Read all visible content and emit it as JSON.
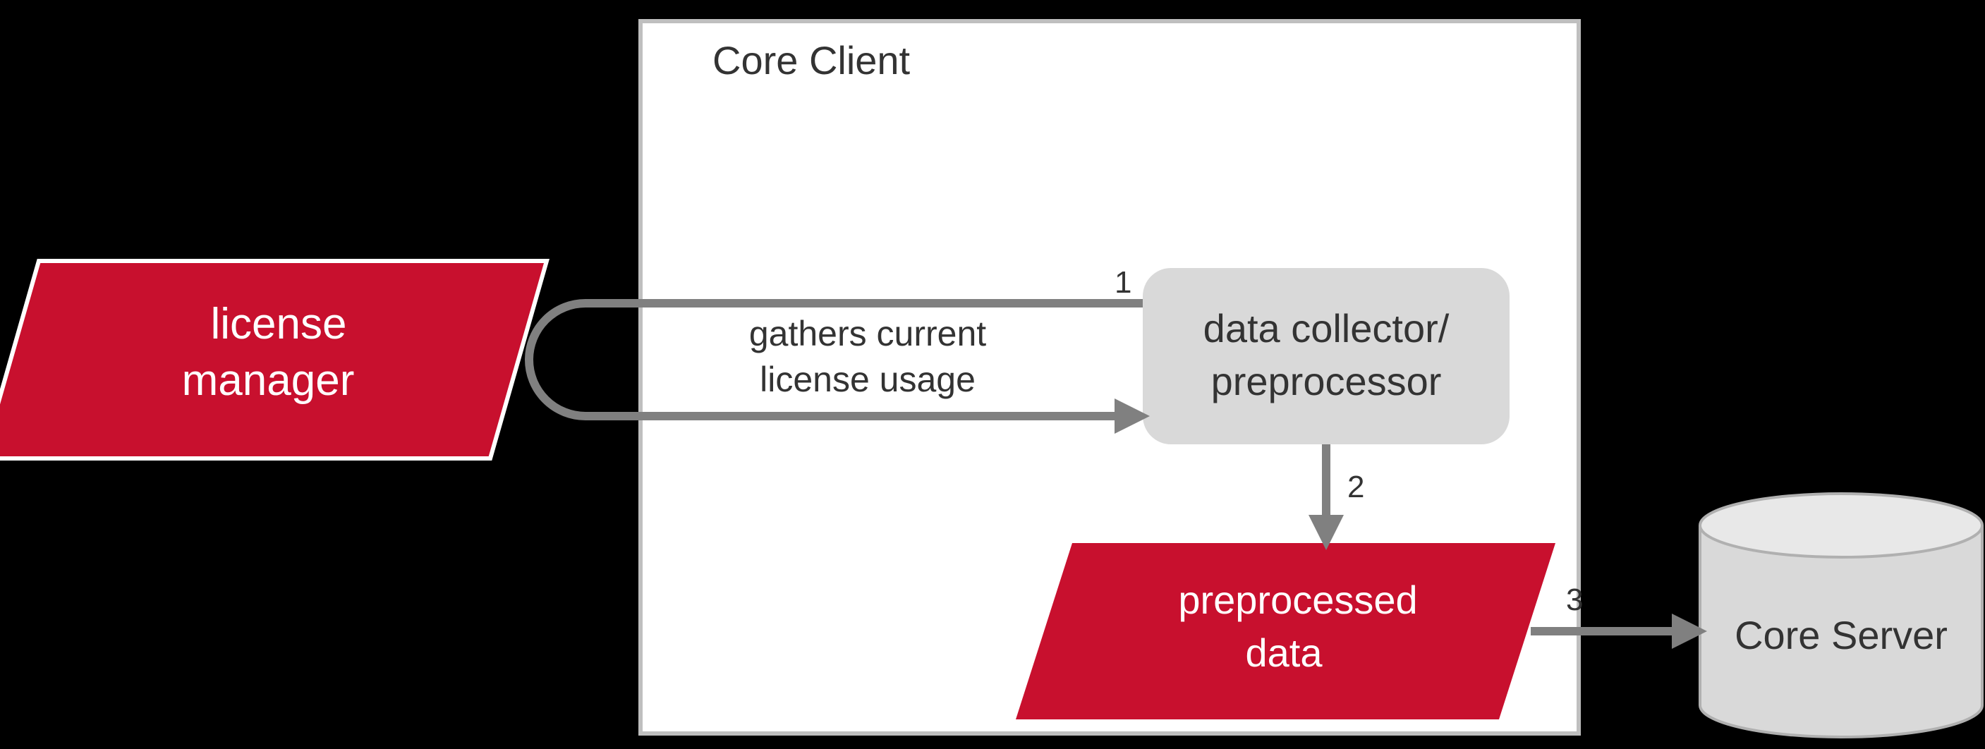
{
  "container": {
    "title": "Core Client"
  },
  "nodes": {
    "license_manager": {
      "line1": "license",
      "line2": "manager"
    },
    "collector": {
      "line1": "data collector/",
      "line2": "preprocessor"
    },
    "preprocessed": {
      "line1": "preprocessed",
      "line2": "data"
    },
    "server": {
      "label": "Core Server"
    }
  },
  "edge_labels": {
    "gathers": {
      "line1": "gathers current",
      "line2": "license usage"
    }
  },
  "step_numbers": {
    "one": "1",
    "two": "2",
    "three": "3"
  },
  "colors": {
    "red": "#c8102e",
    "grey_fill": "#d9d9d9",
    "grey_stroke": "#808080",
    "border": "#bfbfbf"
  }
}
